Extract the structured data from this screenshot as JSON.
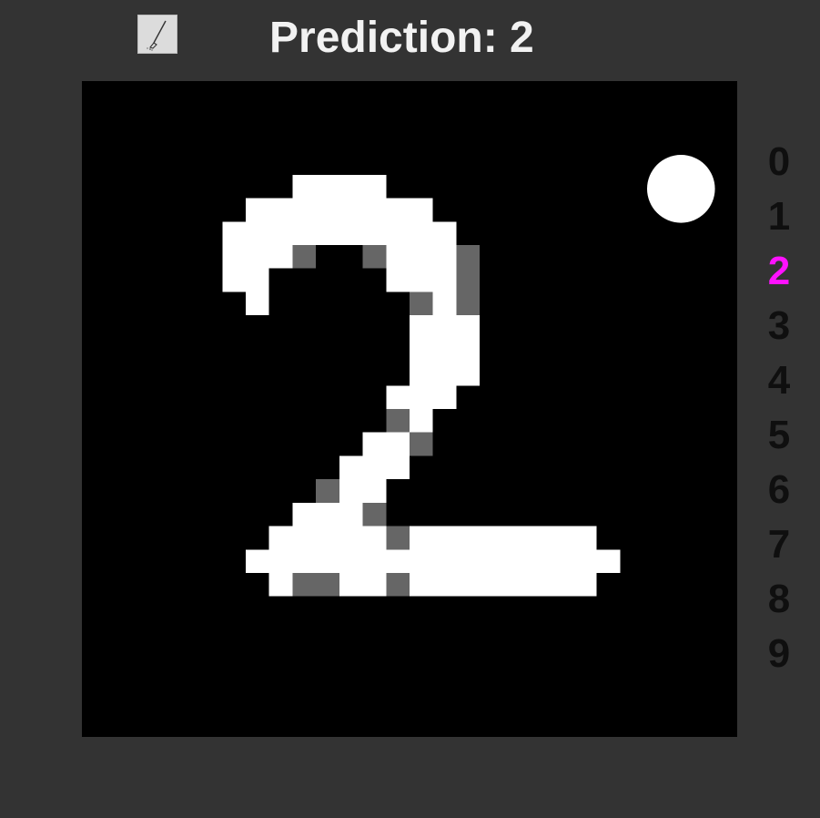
{
  "toolbar": {
    "brush_icon": "brush-icon"
  },
  "header": {
    "prediction_label": "Prediction:",
    "prediction_value": "2"
  },
  "canvas": {
    "background": "#000000",
    "stroke_color": "#ffffff",
    "soft_color": "#666666",
    "cursor_color": "#ffffff"
  },
  "digits": {
    "items": [
      "0",
      "1",
      "2",
      "3",
      "4",
      "5",
      "6",
      "7",
      "8",
      "9"
    ],
    "active_index": 2,
    "active_color": "#ff11ff",
    "default_color": "#0f0f0f"
  }
}
